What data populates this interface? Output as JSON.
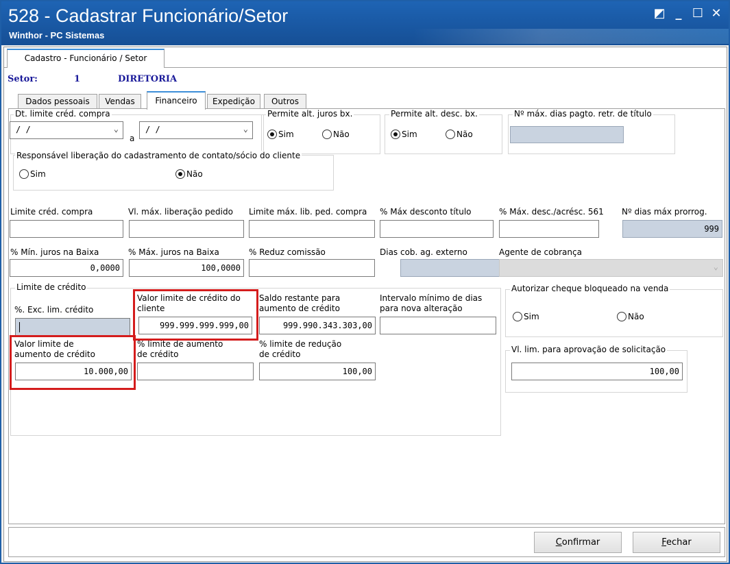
{
  "window": {
    "title": "528 - Cadastrar Funcionário/Setor",
    "subtitle": "Winthor - PC Sistemas",
    "controls": {
      "restore": "◩",
      "minimize": "_",
      "maximize": "☐",
      "close": "✕"
    }
  },
  "outer_tab": "Cadastro - Funcionário / Setor",
  "setor": {
    "label": "Setor:",
    "code": "1",
    "name": "DIRETORIA"
  },
  "tabs": [
    "Dados pessoais",
    "Vendas",
    "Financeiro",
    "Expedição",
    "Outros"
  ],
  "active_tab": "Financeiro",
  "financeiro": {
    "dt_limite": {
      "title": "Dt.  limite créd. compra",
      "from": "/ /",
      "separator": "a",
      "to": "/ /"
    },
    "permite_juros": {
      "title": "Permite alt. juros bx.",
      "sim": "Sim",
      "nao": "Não",
      "selected": "Sim"
    },
    "permite_desc": {
      "title": "Permite alt. desc. bx.",
      "sim": "Sim",
      "nao": "Não",
      "selected": "Sim"
    },
    "max_dias_pagto": {
      "title": "Nº máx. dias pagto. retr. de título",
      "value": ""
    },
    "resp_liberacao": {
      "title": "Responsável liberação do cadastramento de contato/sócio do cliente",
      "sim": "Sim",
      "nao": "Não",
      "selected": "Não"
    },
    "row1": [
      {
        "label": "Limite créd. compra",
        "value": ""
      },
      {
        "label": "Vl. máx. liberação pedido",
        "value": ""
      },
      {
        "label": "Limite máx. lib. ped. compra",
        "value": ""
      },
      {
        "label": "% Máx desconto título",
        "value": ""
      },
      {
        "label": "% Máx. desc./acrésc. 561",
        "value": ""
      },
      {
        "label": "Nº dias máx prorrog.",
        "value": "999"
      }
    ],
    "row2": [
      {
        "label": "% Mín. juros na Baixa",
        "value": "0,0000"
      },
      {
        "label": "% Máx. juros na Baixa",
        "value": "100,0000"
      },
      {
        "label": "% Reduz  comissão",
        "value": ""
      },
      {
        "label": "Dias cob. ag. externo",
        "value": ""
      },
      {
        "label": "Agente de cobrança",
        "value": ""
      }
    ],
    "limite_credito": {
      "title": "Limite de crédito",
      "exc_lim": {
        "label": "%. Exc. lim. crédito",
        "value": ""
      },
      "valor_limite_cliente": {
        "label_1": "Valor limite de crédito do",
        "label_2": "cliente",
        "value": "999.999.999.999,00"
      },
      "saldo_restante": {
        "label_1": "Saldo restante para",
        "label_2": "aumento de crédito",
        "value": "999.990.343.303,00"
      },
      "intervalo_minimo": {
        "label_1": "Intervalo mínimo de dias",
        "label_2": "para nova alteração",
        "value": ""
      },
      "valor_limite_aumento": {
        "label_1": "Valor limite de",
        "label_2": "aumento de crédito",
        "value": "10.000,00"
      },
      "pct_limite_aumento": {
        "label_1": "% limite de aumento",
        "label_2": "de crédito",
        "value": ""
      },
      "pct_limite_reducao": {
        "label_1": "% limite de redução",
        "label_2": "de crédito",
        "value": "100,00"
      }
    },
    "autorizar_cheque": {
      "title": "Autorizar cheque bloqueado na venda",
      "sim": "Sim",
      "nao": "Não",
      "selected": ""
    },
    "vl_lim_aprovacao": {
      "title": "Vl. lim. para aprovação de solicitação",
      "value": "100,00"
    }
  },
  "buttons": {
    "confirm_first": "C",
    "confirm_rest": "onfirmar",
    "close_first": "F",
    "close_rest": "echar"
  },
  "colors": {
    "title_bar": "#1a5aa6",
    "highlight": "#d41c1c",
    "readonly_field": "#c9d3e0",
    "setor_text": "#1a1a9a"
  }
}
